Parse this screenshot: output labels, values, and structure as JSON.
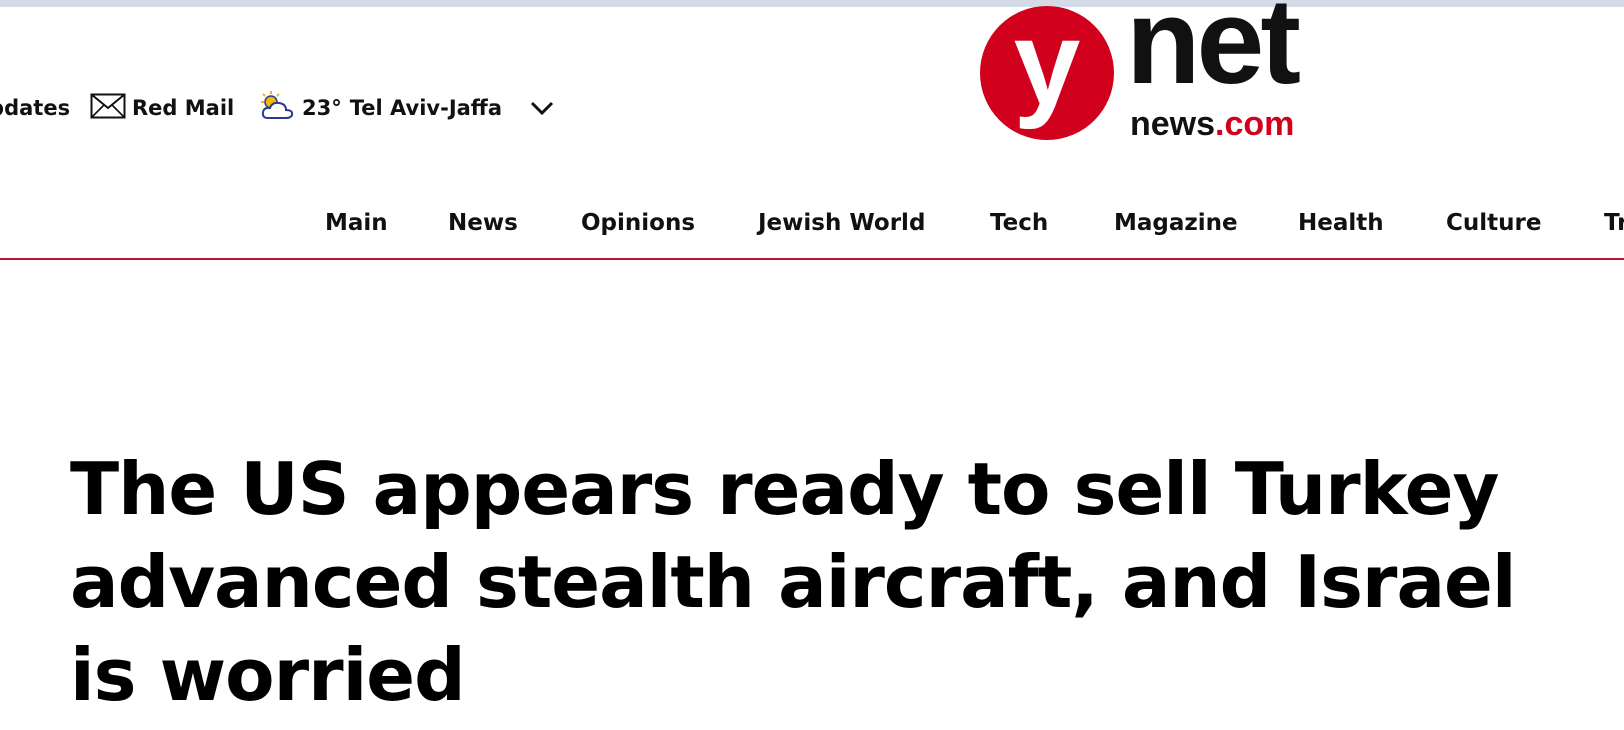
{
  "utility": {
    "updates_label": "Updates",
    "mail_label": "Red Mail",
    "weather_temp": "23°",
    "weather_city": "Tel Aviv-Jaffa",
    "mail_icon": "envelope-icon",
    "weather_icon": "partly-sunny-icon",
    "chevron_icon": "chevron-down-icon"
  },
  "logo": {
    "letter": "y",
    "word": "net",
    "sub_prefix": "news",
    "sub_suffix": ".com",
    "brand_color": "#d1001c"
  },
  "nav": {
    "items": [
      {
        "label": "Main"
      },
      {
        "label": "News"
      },
      {
        "label": "Opinions"
      },
      {
        "label": "Jewish World"
      },
      {
        "label": "Tech"
      },
      {
        "label": "Magazine"
      },
      {
        "label": "Health"
      },
      {
        "label": "Culture"
      },
      {
        "label": "Travel"
      }
    ],
    "underline_color": "#b5182b"
  },
  "article": {
    "headline": "The US appears ready to sell Turkey advanced stealth aircraft, and Israel is worried"
  }
}
